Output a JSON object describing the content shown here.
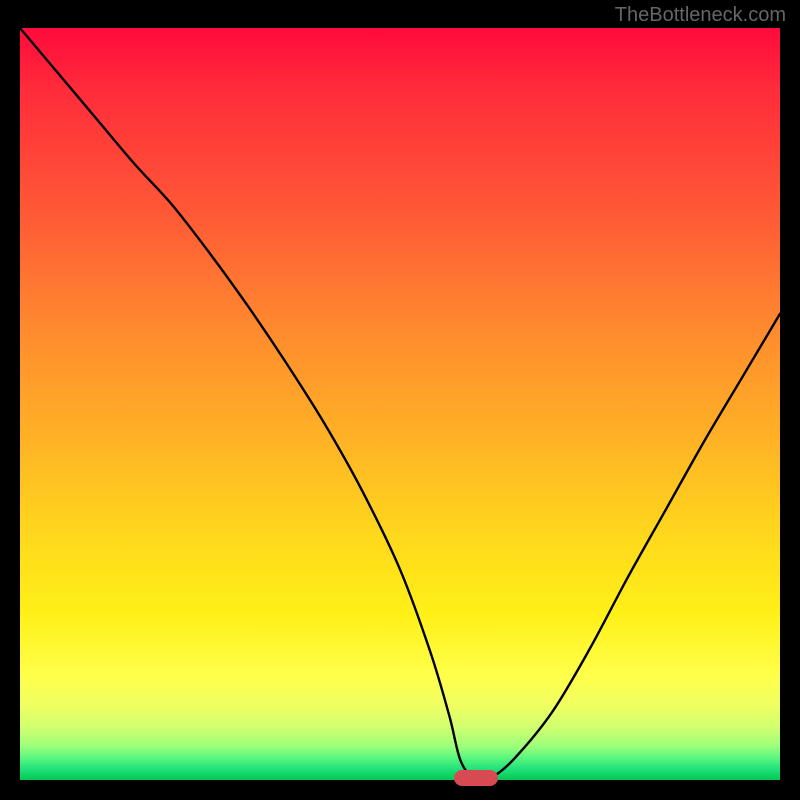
{
  "watermark": "TheBottleneck.com",
  "colors": {
    "frame": "#000000",
    "curve_stroke": "#000000",
    "marker": "#d84a52",
    "watermark_text": "#666666"
  },
  "chart_data": {
    "type": "line",
    "title": "",
    "xlabel": "",
    "ylabel": "",
    "xlim": [
      0,
      100
    ],
    "ylim": [
      0,
      100
    ],
    "grid": false,
    "legend": false,
    "annotations": [],
    "series": [
      {
        "name": "bottleneck-curve",
        "x": [
          0,
          5,
          10,
          15,
          20,
          25,
          30,
          35,
          40,
          45,
          50,
          54,
          56.5,
          58,
          60,
          62,
          65,
          70,
          75,
          80,
          85,
          90,
          95,
          100
        ],
        "y": [
          100,
          94,
          88,
          82,
          76.5,
          70,
          63,
          55.5,
          47.5,
          38.5,
          28,
          17,
          8.5,
          2.5,
          0,
          0.3,
          2.8,
          9,
          17.5,
          27,
          36,
          45,
          53.5,
          62
        ]
      }
    ],
    "marker": {
      "x_center": 60,
      "width_pct": 5.8,
      "y": 0
    },
    "background_gradient": {
      "direction": "vertical",
      "stops_percent_color": [
        [
          0,
          "#ff0a3c"
        ],
        [
          25,
          "#ff5a36"
        ],
        [
          55,
          "#ffb325"
        ],
        [
          80,
          "#ffff4a"
        ],
        [
          97,
          "#5cf77e"
        ],
        [
          100,
          "#03c853"
        ]
      ]
    }
  }
}
